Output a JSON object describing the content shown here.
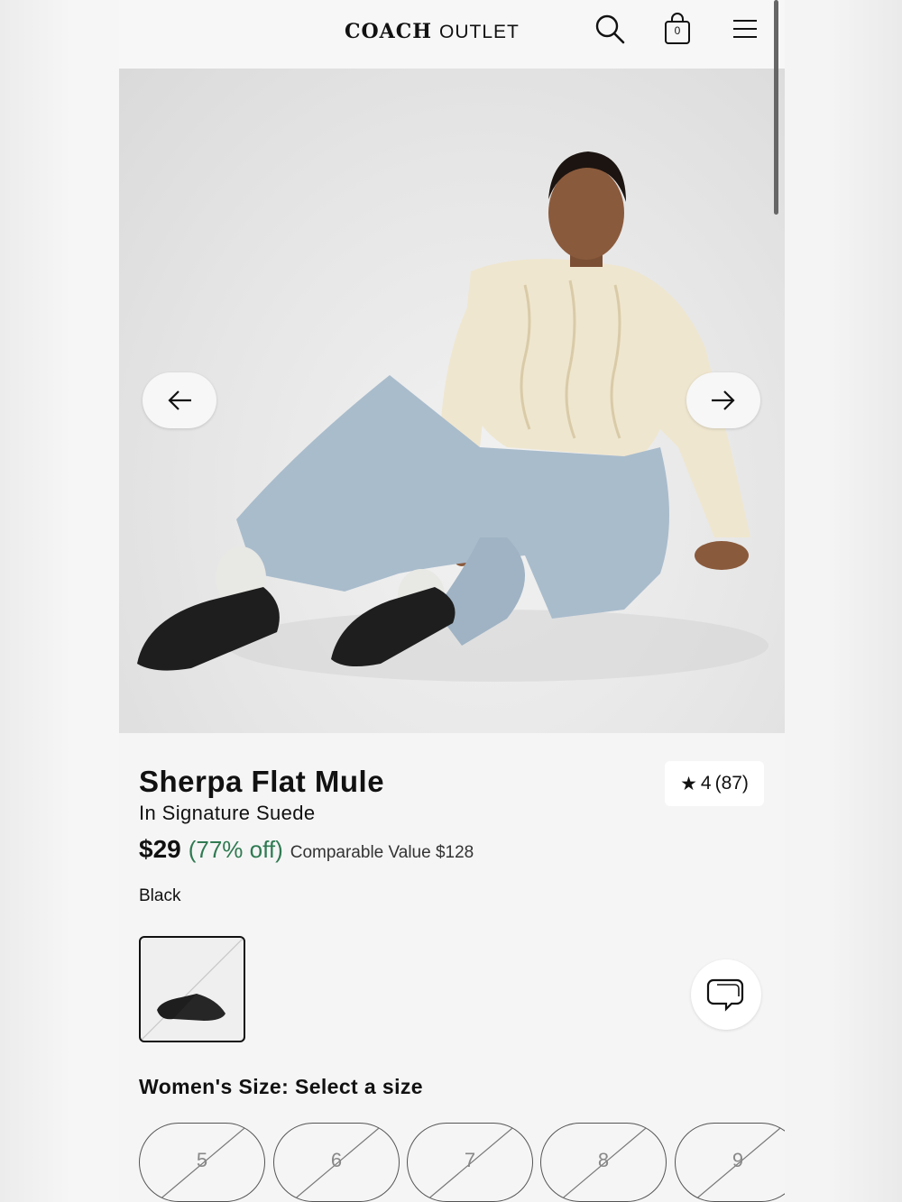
{
  "header": {
    "brand_main": "COACH",
    "brand_sub": "OUTLET",
    "bag_count": "0",
    "icons": [
      "search-icon",
      "shopping-bag-icon",
      "hamburger-menu-icon"
    ]
  },
  "gallery": {
    "image": "product-hero-image",
    "prev_icon": "arrow-left-icon",
    "next_icon": "arrow-right-icon"
  },
  "product": {
    "name": "Sherpa Flat Mule",
    "subtitle": "In Signature Suede",
    "price": "$29",
    "discount": "(77% off)",
    "comparable": "Comparable Value $128",
    "color": "Black",
    "rating": {
      "star": "★",
      "value": "4",
      "count": "(87)"
    },
    "size_heading": "Women's Size: Select a size",
    "sizes": [
      "5",
      "6",
      "7",
      "8",
      "9"
    ]
  },
  "colors": {
    "discount": "#2f7a52",
    "text": "#111111",
    "background": "#f5f5f5"
  }
}
